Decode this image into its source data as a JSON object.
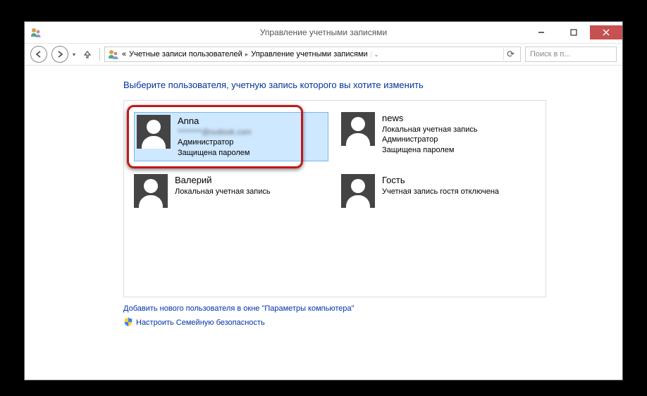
{
  "window": {
    "title": "Управление учетными записями"
  },
  "nav": {
    "crumb1": "Учетные записи пользователей",
    "crumb2": "Управление учетными записями",
    "crumbPrefix": "«"
  },
  "search": {
    "placeholder": "Поиск в п..."
  },
  "heading": "Выберите пользователя, учетную запись которого вы хотите изменить",
  "users": [
    {
      "name": "Anna",
      "email": "********@outlook.com",
      "role": "Администратор",
      "status": "Защищена паролем",
      "selected": true
    },
    {
      "name": "news",
      "type": "Локальная учетная запись",
      "role": "Администратор",
      "status": "Защищена паролем"
    },
    {
      "name": "Валерий",
      "type": "Локальная учетная запись"
    },
    {
      "name": "Гость",
      "type": "Учетная запись гостя отключена"
    }
  ],
  "links": {
    "addUser": "Добавить нового пользователя в окне \"Параметры компьютера\"",
    "familySafety": "Настроить Семейную безопасность"
  }
}
